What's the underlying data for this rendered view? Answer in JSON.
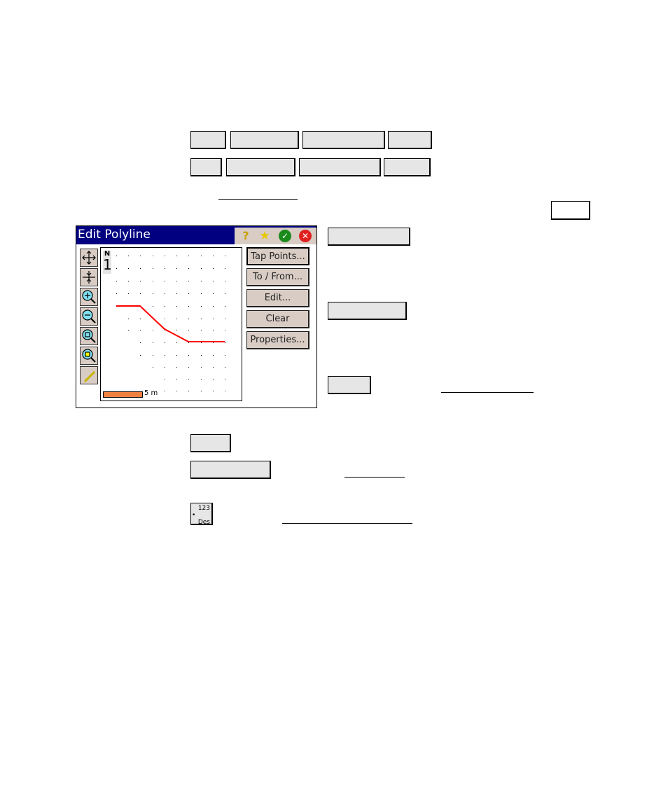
{
  "window": {
    "title": "Edit Polyline",
    "title_icons": [
      "help-icon",
      "favorites-star-icon",
      "ok-check-icon",
      "close-x-icon"
    ]
  },
  "tools": [
    "pan-icon",
    "center-icon",
    "zoom-in-icon",
    "zoom-out-icon",
    "zoom-extents-icon",
    "zoom-to-point-icon",
    "map-edit-icon"
  ],
  "map": {
    "north_label": "N",
    "north_arrow": "1",
    "scale_label": "5 m",
    "scale_color": "#f08040",
    "line_color": "#ff0000"
  },
  "buttons": [
    "Tap Points...",
    "To / From...",
    "Edit...",
    "Clear",
    "Properties..."
  ],
  "des_icon": {
    "top": "123",
    "bottom": "Des"
  }
}
